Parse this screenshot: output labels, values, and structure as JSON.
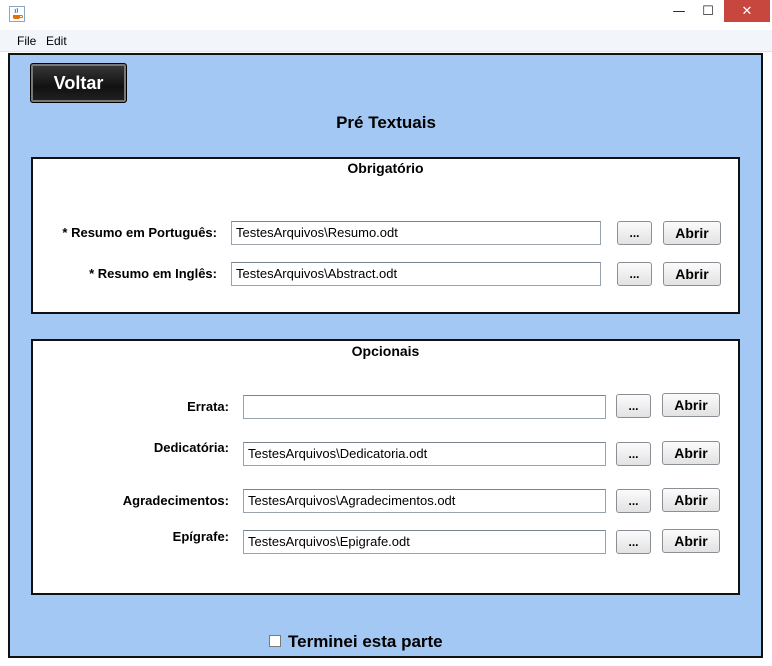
{
  "window": {
    "minimize_glyph": "—",
    "maximize_glyph": "☐",
    "close_glyph": "✕",
    "icon": "java-cup-icon"
  },
  "menu": [
    "File",
    "Edit"
  ],
  "toolbar": {
    "back_label": "Voltar"
  },
  "page": {
    "title": "Pré Textuais"
  },
  "obrigatorio": {
    "title": "Obrigatório",
    "fields": [
      {
        "label": "* Resumo em Português:",
        "value": "TestesArquivos\\Resumo.odt"
      },
      {
        "label": "* Resumo em Inglês:",
        "value": "TestesArquivos\\Abstract.odt"
      }
    ]
  },
  "opcionais": {
    "title": "Opcionais",
    "fields": [
      {
        "label": "Errata:",
        "value": ""
      },
      {
        "label": "Dedicatória:",
        "value": "TestesArquivos\\Dedicatoria.odt"
      },
      {
        "label": "Agradecimentos:",
        "value": "TestesArquivos\\Agradecimentos.odt"
      },
      {
        "label": "Epígrafe:",
        "value": "TestesArquivos\\Epigrafe.odt"
      }
    ]
  },
  "buttons": {
    "browse": "...",
    "open": "Abrir"
  },
  "footer": {
    "checkbox_label": "Terminei esta parte",
    "checked": false
  },
  "colors": {
    "panel_bg": "#a4c8f4",
    "close_red": "#c7463d"
  }
}
